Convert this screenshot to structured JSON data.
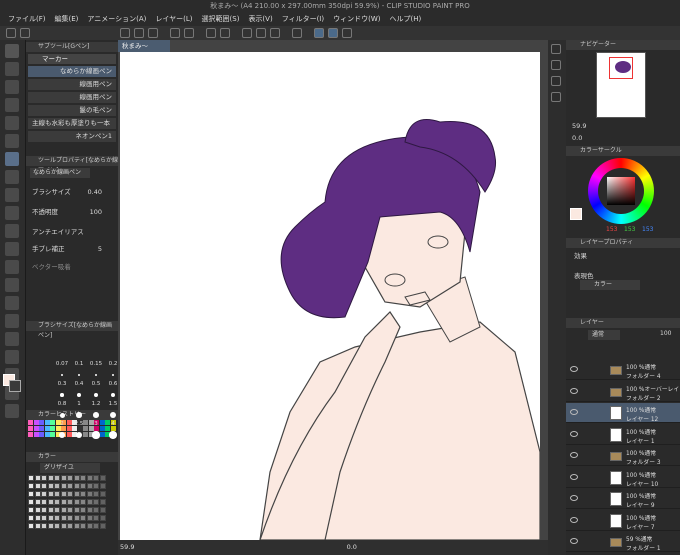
{
  "window": {
    "title": "秋まみ〜 (A4 210.00 x 297.00mm 350dpi 59.9%) - CLIP STUDIO PAINT PRO"
  },
  "menu": [
    "ファイル(F)",
    "編集(E)",
    "アニメーション(A)",
    "レイヤー(L)",
    "選択範囲(S)",
    "表示(V)",
    "フィルター(I)",
    "ウィンドウ(W)",
    "ヘルプ(H)"
  ],
  "sub_tool": {
    "header": "サブツール[Gペン]",
    "group": "マーカー",
    "items": [
      "なめらか線画ペン",
      "線画用ペン",
      "線画用ペン",
      "鬣の毛ペン",
      "主線も水彩も厚塗りも一本で",
      "ネオンペン1"
    ]
  },
  "tool_property": {
    "header": "ツールプロパティ[なめらか線画ペン]",
    "brush_name": "なめらか線画ペン",
    "rows": {
      "brush_size_label": "ブラシサイズ",
      "brush_size_value": "0.40",
      "opacity_label": "不透明度",
      "opacity_value": "100",
      "antialias_label": "アンチエイリアス",
      "stabilization_label": "手ブレ補正",
      "stabilization_value": "5",
      "vector_label": "ベクター吸着"
    }
  },
  "brush_size": {
    "header": "ブラシサイズ[なめらか線画ペン]",
    "labels": [
      "0.07",
      "0.1",
      "0.15",
      "0.2",
      "0.25",
      "0.3",
      "0.4",
      "0.5",
      "0.6",
      "0.7",
      "0.8",
      "1",
      "1.2",
      "1.5",
      "1.7",
      "2",
      "2.5",
      "3",
      "4",
      "5"
    ]
  },
  "color_history": {
    "header": "カラーヒストリー"
  },
  "color_set": {
    "header": "カラー",
    "dropdown": "グリザイユ"
  },
  "canvas": {
    "tab": "秋まみ〜",
    "zoom": "59.9",
    "rotation": "0.0",
    "colors": {
      "hair": "#5e2d82",
      "skin": "#fbe9e1",
      "line": "#3a3a3a"
    }
  },
  "navigator": {
    "header": "ナビゲーター",
    "zoom": "59.9",
    "angle": "0.0"
  },
  "color_circle": {
    "header": "カラーサークル",
    "h": "153",
    "s": "153",
    "v": "153"
  },
  "layer_property": {
    "header": "レイヤープロパティ",
    "effect_label": "効果",
    "expression_label": "表現色",
    "expression_value": "カラー"
  },
  "layer_panel": {
    "header": "レイヤー",
    "blend": "通常",
    "opacity": "100",
    "layers": [
      {
        "name": "フォルダー 4",
        "info": "100 %通常",
        "type": "folder"
      },
      {
        "name": "フォルダー 2",
        "info": "100 %オーバーレイ",
        "type": "folder"
      },
      {
        "name": "レイヤー 12",
        "info": "100 %通常",
        "type": "layer",
        "selected": true
      },
      {
        "name": "レイヤー 1",
        "info": "100 %通常",
        "type": "layer"
      },
      {
        "name": "フォルダー 3",
        "info": "100 %通常",
        "type": "folder"
      },
      {
        "name": "レイヤー 10",
        "info": "100 %通常",
        "type": "layer"
      },
      {
        "name": "レイヤー 9",
        "info": "100 %通常",
        "type": "layer"
      },
      {
        "name": "レイヤー 7",
        "info": "100 %通常",
        "type": "layer"
      },
      {
        "name": "フォルダー 1",
        "info": "59 %通常",
        "type": "folder"
      }
    ]
  }
}
